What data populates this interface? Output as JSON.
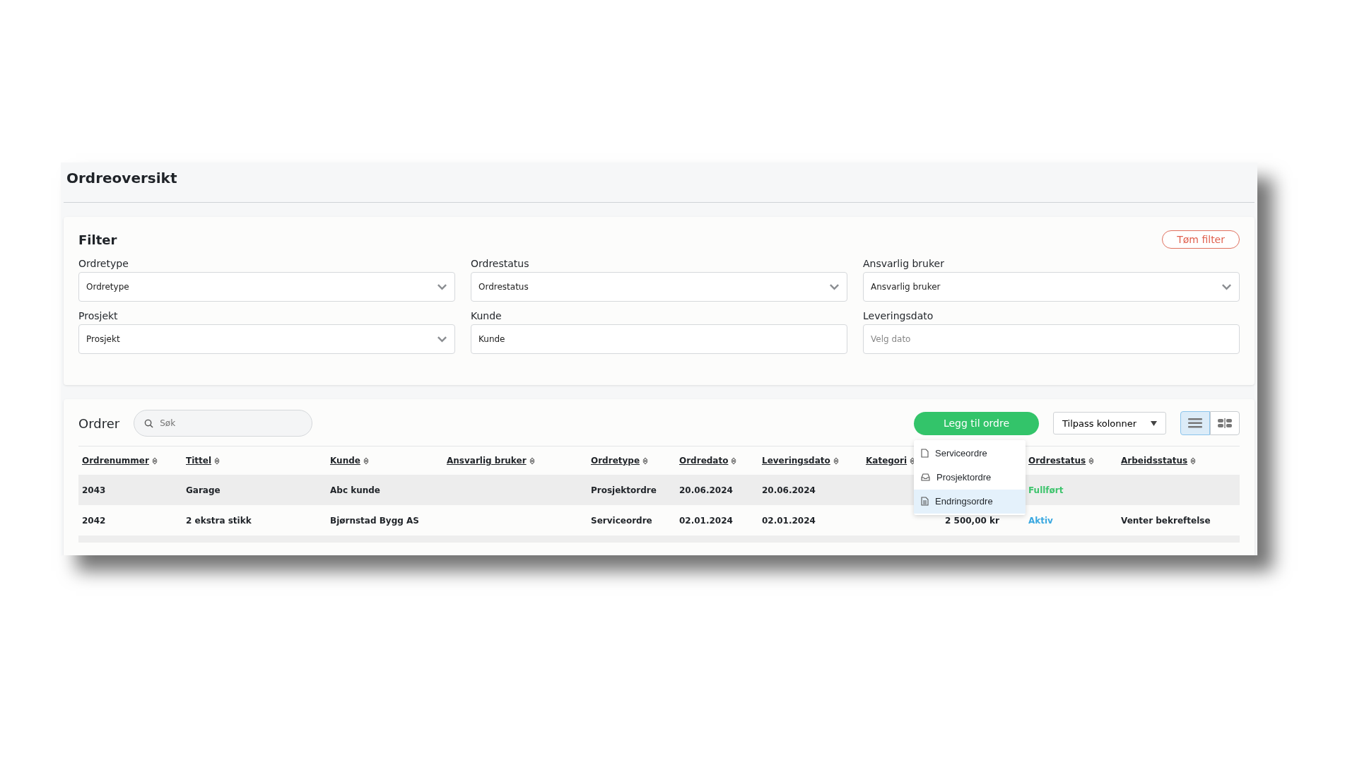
{
  "page": {
    "title": "Ordreoversikt"
  },
  "filter": {
    "title": "Filter",
    "clear_button": "Tøm filter",
    "fields": [
      {
        "kind": "select",
        "label": "Ordretype",
        "value": "Ordretype"
      },
      {
        "kind": "select",
        "label": "Ordrestatus",
        "value": "Ordrestatus"
      },
      {
        "kind": "select",
        "label": "Ansvarlig bruker",
        "value": "Ansvarlig bruker"
      },
      {
        "kind": "select",
        "label": "Prosjekt",
        "value": "Prosjekt"
      },
      {
        "kind": "text",
        "label": "Kunde",
        "value": "Kunde"
      },
      {
        "kind": "date",
        "label": "Leveringsdato",
        "placeholder": "Velg dato"
      }
    ]
  },
  "orders": {
    "title": "Ordrer",
    "search": {
      "placeholder": "Søk"
    },
    "add_button": "Legg til ordre",
    "add_menu": {
      "expanded": true,
      "items": [
        {
          "label": "Serviceordre",
          "selected": false
        },
        {
          "label": "Prosjektordre",
          "selected": false
        },
        {
          "label": "Endringsordre",
          "selected": true
        }
      ]
    },
    "columns_button": "Tilpass kolonner",
    "views": [
      {
        "kind": "list",
        "selected": true
      },
      {
        "kind": "split",
        "selected": false
      }
    ],
    "table": {
      "columns": [
        {
          "label": "Ordrenummer"
        },
        {
          "label": "Tittel"
        },
        {
          "label": "Kunde"
        },
        {
          "label": "Ansvarlig bruker"
        },
        {
          "label": "Ordretype"
        },
        {
          "label": "Ordredato"
        },
        {
          "label": "Leveringsdato"
        },
        {
          "label": "Kategori"
        },
        {},
        {
          "label": "Ordrestatus"
        },
        {
          "label": "Arbeidsstatus"
        }
      ],
      "rows": [
        {
          "selected": true,
          "cells": [
            "2043",
            "Garage",
            "Abc kunde",
            null,
            "Prosjektordre",
            "20.06.2024",
            "20.06.2024",
            null,
            null,
            null,
            null
          ],
          "status": {
            "text": "Fullført",
            "color": "#3ec46d"
          }
        },
        {
          "selected": false,
          "cells": [
            "2042",
            "2 ekstra stikk",
            "Bjørnstad Bygg AS",
            null,
            "Serviceordre",
            "02.01.2024",
            "02.01.2024",
            null,
            "2 500,00 kr",
            null,
            "Venter bekreftelse"
          ],
          "status": {
            "text": "Aktiv",
            "color": "#3aa8e0"
          }
        }
      ]
    }
  }
}
